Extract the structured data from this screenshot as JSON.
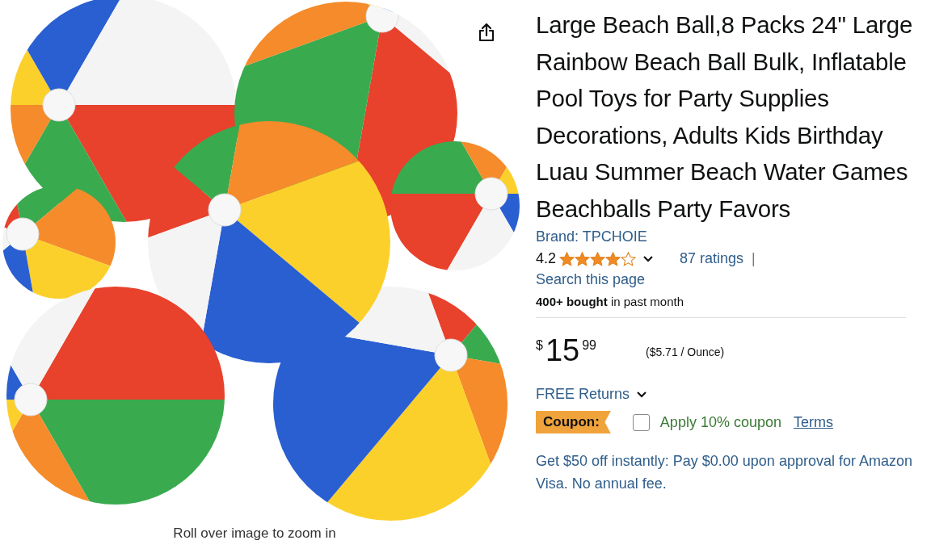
{
  "image": {
    "caption": "Roll over image to zoom in"
  },
  "product": {
    "title": "Large Beach Ball,8 Packs 24\" Large Rainbow Beach Ball Bulk, Inflatable Pool Toys for Party Supplies Decorations, Adults Kids Birthday Luau Summer Beach Water Games Beachballs Party Favors",
    "brand": "Brand: TPCHOIE",
    "rating": "4.2",
    "stars": 4,
    "ratings_count": "87 ratings",
    "separator": "|",
    "search_link": "Search this page",
    "bought": "**400+ bought** in past month"
  },
  "price": {
    "currency": "$",
    "whole": "15",
    "fraction": "99",
    "unit_price": "($5.71 / Ounce)"
  },
  "returns": "FREE Returns",
  "coupon": {
    "badge": "Coupon:",
    "checked": false,
    "label": "Apply 10% coupon",
    "terms": "Terms"
  },
  "offer": "Get $50 off instantly: Pay $0.00 upon approval for Amazon Visa. No annual fee."
}
